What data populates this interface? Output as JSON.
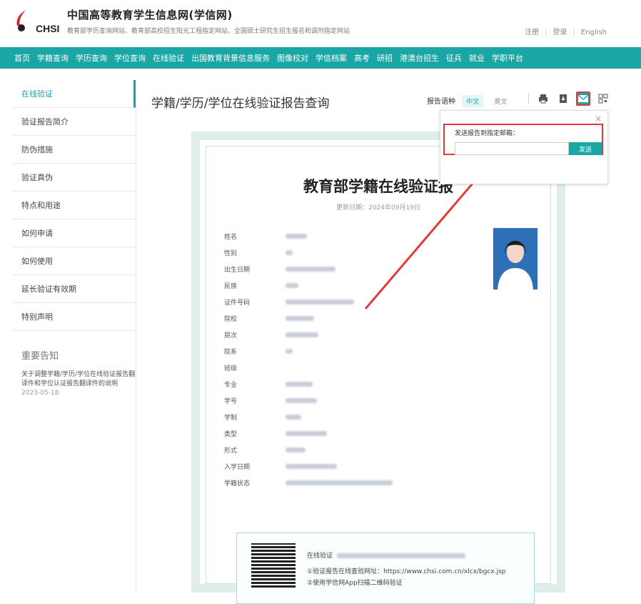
{
  "header": {
    "title": "中国高等教育学生信息网(学信网)",
    "brand": "CHSI",
    "subtitle": "教育部学历查询网站、教育部高校招生阳光工程指定网站、全国硕士研究生招生报名和调剂指定网站",
    "links": [
      "注册",
      "登录",
      "English"
    ]
  },
  "nav": {
    "items": [
      "首页",
      "学籍查询",
      "学历查询",
      "学位查询",
      "在线验证",
      "出国教育背景信息服务",
      "图像校对",
      "学信档案",
      "高考",
      "研招",
      "港澳台招生",
      "征兵",
      "就业",
      "学职平台"
    ]
  },
  "sidebar": {
    "items": [
      "在线验证",
      "验证报告简介",
      "防伪措施",
      "验证真伪",
      "特点和用途",
      "如何申请",
      "如何使用",
      "延长验证有效期",
      "特别声明"
    ],
    "notice_title": "重要告知",
    "notice_text": "关于调整学籍/学历/学位在线验证报告翻译件和学位认证报告翻译件的说明",
    "notice_date": "2023-05-18"
  },
  "main": {
    "title": "学籍/学历/学位在线验证报告查询",
    "lang_label": "报告语种",
    "lang_zh": "中文",
    "lang_en": "英文"
  },
  "report": {
    "title": "教育部学籍在线验证报",
    "update": "更新日期：2024年09月19日",
    "fields": [
      {
        "label": "姓名",
        "w": 30
      },
      {
        "label": "性别",
        "w": 10
      },
      {
        "label": "出生日期",
        "w": 70
      },
      {
        "label": "民族",
        "w": 18
      },
      {
        "label": "证件号码",
        "w": 96
      },
      {
        "label": "院校",
        "w": 40
      },
      {
        "label": "层次",
        "w": 46
      },
      {
        "label": "院系",
        "w": 10
      },
      {
        "label": "班级",
        "w": 0
      },
      {
        "label": "专业",
        "w": 38
      },
      {
        "label": "学号",
        "w": 44
      },
      {
        "label": "学制",
        "w": 22
      },
      {
        "label": "类型",
        "w": 58
      },
      {
        "label": "形式",
        "w": 28
      },
      {
        "label": "入学日期",
        "w": 72
      },
      {
        "label": "学籍状态",
        "w": 150
      }
    ],
    "verify_prefix": "在线验证",
    "verify_line2": "①验证报告在线查验网址：https://www.chsi.com.cn/xlcx/bgcx.jsp",
    "verify_line3": "②使用学信网App扫描二维码验证"
  },
  "popup": {
    "label": "发送报告到指定邮箱：",
    "send": "发送"
  },
  "colors": {
    "accent": "#1aa6a4",
    "highlight": "#e23a3a"
  }
}
